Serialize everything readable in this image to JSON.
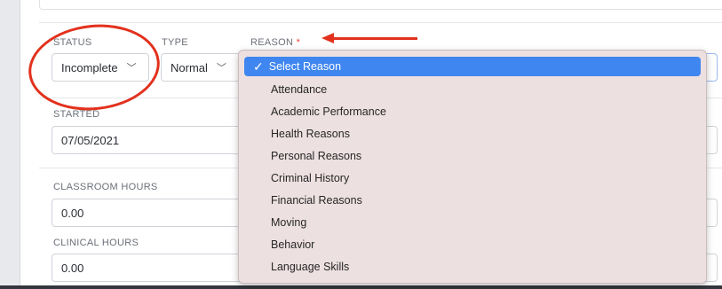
{
  "form": {
    "status": {
      "label": "STATUS",
      "value": "Incomplete"
    },
    "type": {
      "label": "TYPE",
      "value": "Normal"
    },
    "reason": {
      "label": "REASON",
      "required_mark": "*"
    },
    "started": {
      "label": "STARTED",
      "value": "07/05/2021"
    },
    "classroom_hours": {
      "label": "CLASSROOM HOURS",
      "value": "0.00"
    },
    "clinical_hours": {
      "label": "CLINICAL HOURS",
      "value": "0.00"
    }
  },
  "reason_menu": {
    "selected": "Select Reason",
    "check_glyph": "✓",
    "items": [
      "Attendance",
      "Academic Performance",
      "Health Reasons",
      "Personal Reasons",
      "Criminal History",
      "Financial Reasons",
      "Moving",
      "Behavior",
      "Language Skills"
    ]
  },
  "colors": {
    "annotation": "#e2311d",
    "highlight": "#3f86f0",
    "required": "#e5483a"
  },
  "icons": {
    "chevron": "chevron-down-icon",
    "check": "checkmark-icon"
  }
}
